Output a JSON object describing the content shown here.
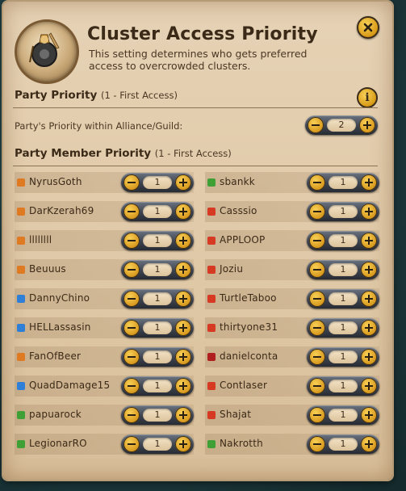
{
  "dialog": {
    "title": "Cluster Access Priority",
    "subtitle": "This setting determines who gets preferred access to overcrowded clusters.",
    "close_icon": "close-x-icon"
  },
  "party_priority": {
    "heading": "Party Priority",
    "heading_sub": "(1 - First Access)",
    "label": "Party's Priority within Alliance/Guild:",
    "value": "2",
    "info_icon": "info-icon"
  },
  "member_priority": {
    "heading": "Party Member Priority",
    "heading_sub": "(1 - First Access)",
    "left": [
      {
        "name": "NyrusGoth",
        "value": "1",
        "role": "flame-role-icon",
        "color": "#e07a22"
      },
      {
        "name": "DarKzerah69",
        "value": "1",
        "role": "flame-role-icon",
        "color": "#e07a22"
      },
      {
        "name": "llllllll",
        "value": "1",
        "role": "flame-role-icon",
        "color": "#e07a22"
      },
      {
        "name": "Beuuus",
        "value": "1",
        "role": "flame-role-icon",
        "color": "#e07a22"
      },
      {
        "name": "DannyChino",
        "value": "1",
        "role": "shield-role-icon",
        "color": "#2f7fd6"
      },
      {
        "name": "HELLassasin",
        "value": "1",
        "role": "shield-role-icon",
        "color": "#2f7fd6"
      },
      {
        "name": "FanOfBeer",
        "value": "1",
        "role": "flame-role-icon",
        "color": "#e07a22"
      },
      {
        "name": "QuadDamage15",
        "value": "1",
        "role": "shield-role-icon",
        "color": "#2f7fd6"
      },
      {
        "name": "papuarock",
        "value": "1",
        "role": "heal-role-icon",
        "color": "#3fa035"
      },
      {
        "name": "LegionarRO",
        "value": "1",
        "role": "heal-role-icon",
        "color": "#3fa035"
      }
    ],
    "right": [
      {
        "name": "sbankk",
        "value": "1",
        "role": "heal-role-icon",
        "color": "#3fa035"
      },
      {
        "name": "Casssio",
        "value": "1",
        "role": "sword-role-icon",
        "color": "#d63a22"
      },
      {
        "name": "APPLOOP",
        "value": "1",
        "role": "sword-role-icon",
        "color": "#d63a22"
      },
      {
        "name": "Joziu",
        "value": "1",
        "role": "sword-role-icon",
        "color": "#d63a22"
      },
      {
        "name": "TurtleTaboo",
        "value": "1",
        "role": "sword-role-icon",
        "color": "#d63a22"
      },
      {
        "name": "thirtyone31",
        "value": "1",
        "role": "sword-role-icon",
        "color": "#d63a22"
      },
      {
        "name": "danielconta",
        "value": "1",
        "role": "sword-role-icon",
        "color": "#b02020"
      },
      {
        "name": "Contlaser",
        "value": "1",
        "role": "sword-role-icon",
        "color": "#d63a22"
      },
      {
        "name": "Shajat",
        "value": "1",
        "role": "sword-role-icon",
        "color": "#d63a22"
      },
      {
        "name": "Nakrotth",
        "value": "1",
        "role": "heal-role-icon",
        "color": "#3fa035"
      }
    ]
  }
}
